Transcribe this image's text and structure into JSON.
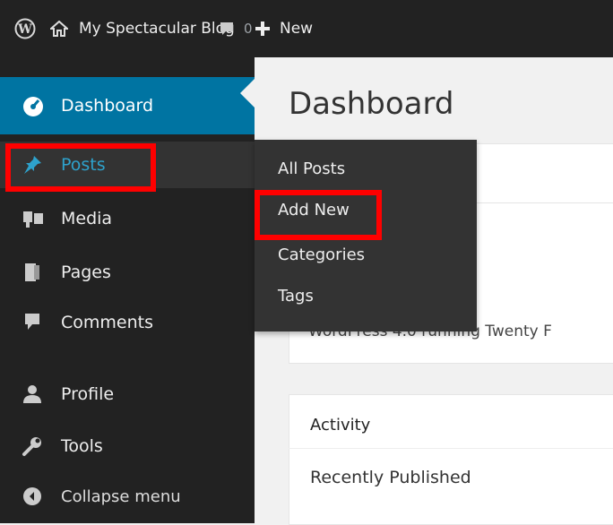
{
  "admin_bar": {
    "site_name": "My Spectacular Blog",
    "comment_count": "0",
    "new_label": "New"
  },
  "sidebar": {
    "items": [
      {
        "label": "Dashboard",
        "icon": "dashboard-icon",
        "state": "current"
      },
      {
        "label": "Posts",
        "icon": "pushpin-icon",
        "state": "hover"
      },
      {
        "label": "Media",
        "icon": "media-icon"
      },
      {
        "label": "Pages",
        "icon": "pages-icon"
      },
      {
        "label": "Comments",
        "icon": "comment-icon"
      },
      {
        "label": "Profile",
        "icon": "user-icon"
      },
      {
        "label": "Tools",
        "icon": "wrench-icon"
      },
      {
        "label": "Collapse menu",
        "icon": "collapse-icon"
      }
    ]
  },
  "posts_submenu": {
    "items": [
      "All Posts",
      "Add New",
      "Categories",
      "Tags"
    ]
  },
  "main": {
    "title": "Dashboard",
    "at_a_glance_line": "WordPress 4.0 running Twenty F",
    "activity": {
      "title": "Activity",
      "recently_published": "Recently Published"
    }
  },
  "colors": {
    "adminbar_bg": "#222222",
    "current_item_bg": "#0074a2",
    "hover_text": "#2ea2cc",
    "highlight": "#ff0000"
  }
}
